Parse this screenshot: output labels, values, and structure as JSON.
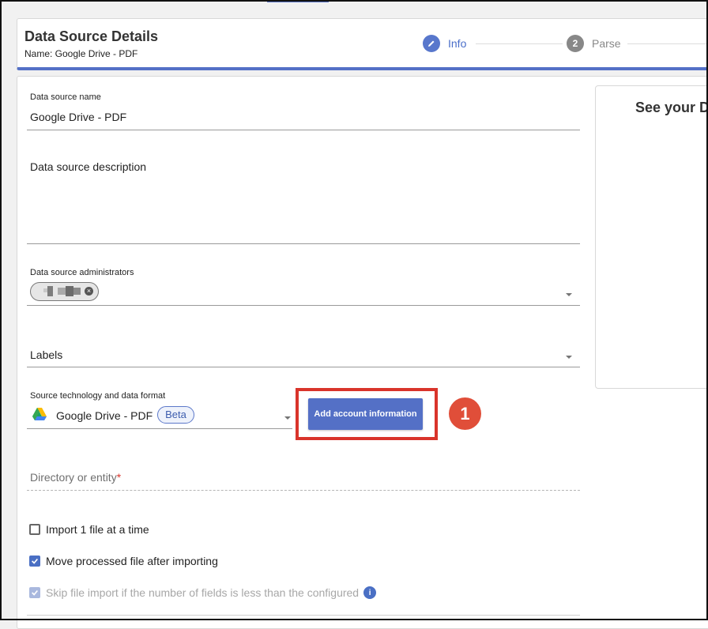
{
  "header": {
    "title": "Data Source Details",
    "subtitle": "Name: Google Drive - PDF",
    "steps": [
      {
        "number": "",
        "label": "Info",
        "state": "active",
        "icon": "pencil-icon"
      },
      {
        "number": "2",
        "label": "Parse",
        "state": "inactive"
      }
    ]
  },
  "form": {
    "name": {
      "label": "Data source name",
      "value": "Google Drive - PDF"
    },
    "description": {
      "placeholder": "Data source description"
    },
    "administrators": {
      "label": "Data source administrators",
      "chip_remove_icon": "close-icon"
    },
    "labels": {
      "placeholder": "Labels"
    },
    "source": {
      "label": "Source technology and data format",
      "value": "Google Drive - PDF",
      "badge": "Beta",
      "icon": "google-drive-icon"
    },
    "add_account_button": "Add account information",
    "directory": {
      "label": "Directory or entity",
      "required_mark": "*"
    },
    "checkboxes": [
      {
        "label": "Import 1 file at a time",
        "checked": false,
        "disabled": false
      },
      {
        "label": "Move processed file after importing",
        "checked": true,
        "disabled": false
      },
      {
        "label": "Skip file import if the number of fields is less than the configured",
        "checked": true,
        "disabled": true
      }
    ]
  },
  "side_panel": {
    "title": "See your D"
  },
  "annotation": {
    "step_number": "1"
  },
  "colors": {
    "accent": "#5470c6",
    "highlight": "#d9342b",
    "marker": "#e04e39"
  }
}
